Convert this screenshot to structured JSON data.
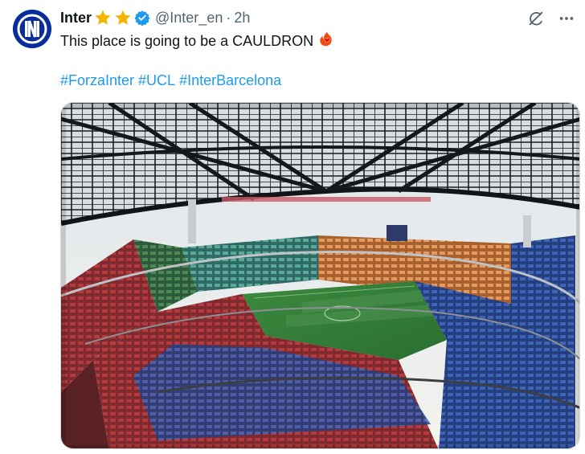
{
  "author": {
    "display_name": "Inter",
    "handle": "@Inter_en",
    "separator": "·",
    "time": "2h",
    "badges": [
      "star-icon",
      "star-icon",
      "verified-icon"
    ],
    "colors": {
      "star": "#f4b400",
      "verified": "#1d9bf0",
      "avatar_bg": "#0a2d9c"
    }
  },
  "tweet": {
    "text": "This place is going to be a CAULDRON",
    "emoji": "fire-heart-icon",
    "hashtags": [
      "#ForzaInter",
      "#UCL",
      "#InterBarcelona"
    ]
  },
  "media": {
    "kind": "photo",
    "subject": "stadium"
  },
  "actions": {
    "grok_icon": "grok-icon",
    "more_icon": "more-icon"
  }
}
